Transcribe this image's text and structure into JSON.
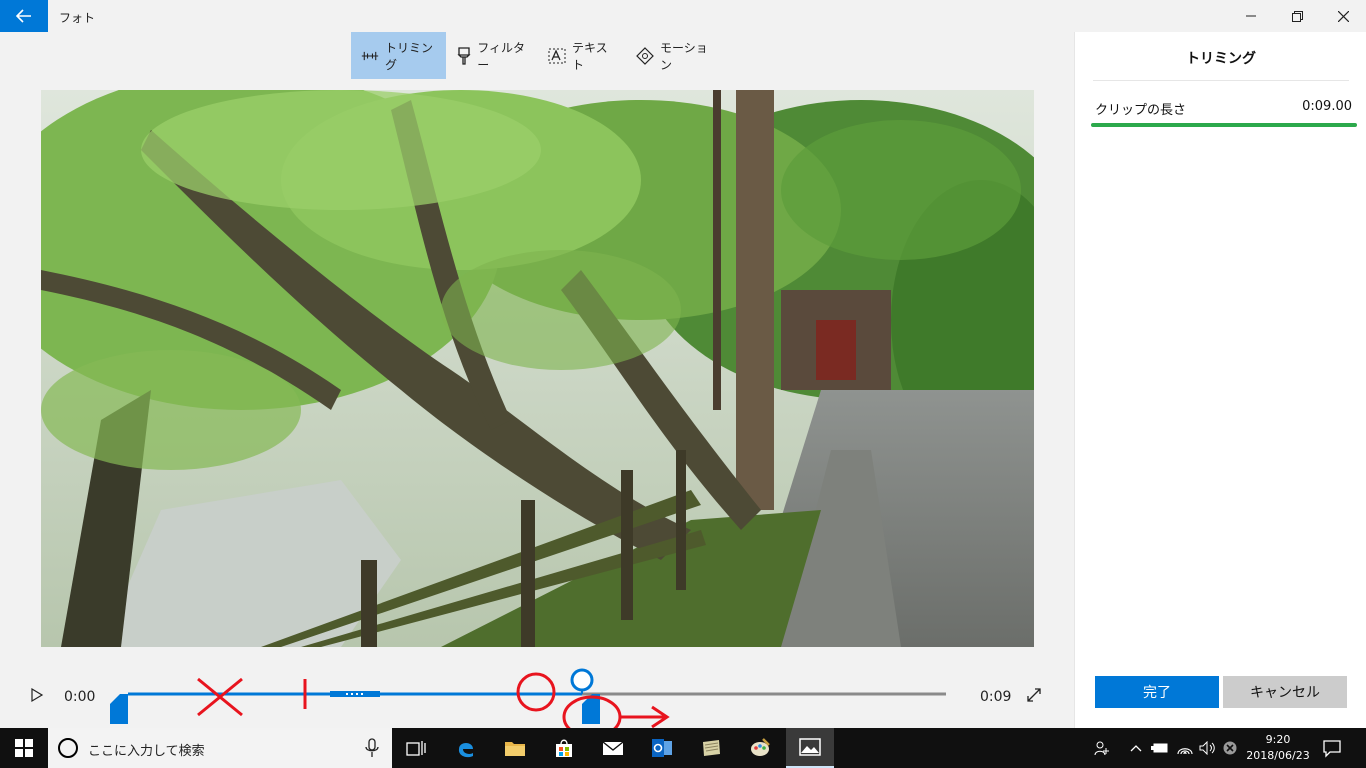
{
  "titlebar": {
    "app_title": "フォト",
    "back_icon": "back-arrow-icon",
    "minimize_icon": "minimize-icon",
    "maximize_icon": "restore-icon",
    "close_icon": "close-icon"
  },
  "toolbar": {
    "tools": [
      {
        "label": "トリミング",
        "icon": "trim-icon",
        "active": true
      },
      {
        "label": "フィルター",
        "icon": "filter-icon",
        "active": false
      },
      {
        "label": "テキスト",
        "icon": "text-icon",
        "active": false
      },
      {
        "label": "モーション",
        "icon": "motion-icon",
        "active": false
      }
    ]
  },
  "video": {
    "description_icon": "video-frame"
  },
  "timeline": {
    "time_start": "0:00",
    "time_end": "0:09",
    "playhead_fraction": 0.55,
    "trim_start_fraction": 0.0,
    "trim_end_fraction": 0.55
  },
  "panel": {
    "title": "トリミング",
    "clip_length_label": "クリップの長さ",
    "clip_length_value": "0:09.00",
    "done_label": "完了",
    "cancel_label": "キャンセル"
  },
  "taskbar": {
    "search_placeholder": "ここに入力して検索",
    "time": "9:20",
    "date": "2018/06/23"
  },
  "colors": {
    "accent": "#0078d7",
    "toolbar_active": "#a6cbee",
    "clip_bar": "#2ca94c",
    "annotation_red": "#e8141e",
    "taskbar": "#101010"
  }
}
